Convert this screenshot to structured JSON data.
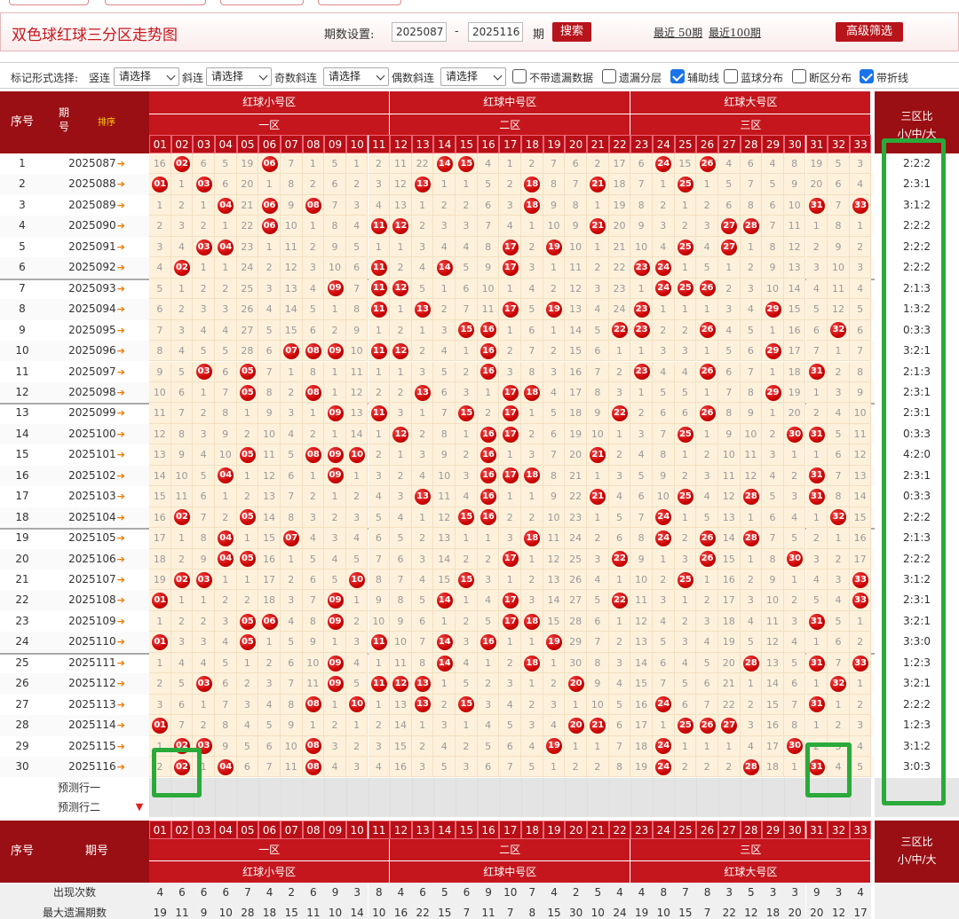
{
  "header": {
    "title": "双色球红球三分区走势图",
    "period_label": "期数设置:",
    "from": "2025087",
    "dash": "-",
    "to": "2025116",
    "qi": "期",
    "search_btn": "搜索",
    "recent50": "最近 50期",
    "recent100": "最近100期",
    "advanced_btn": "高级筛选"
  },
  "filters": {
    "mark_label": "标记形式选择:",
    "vertical": "竖连",
    "slant": "斜连",
    "odd_slant": "奇数斜连",
    "even_slant": "偶数斜连",
    "select_ph": "请选择",
    "cb1": "不带遗漏数据",
    "cb2": "遗漏分层",
    "cb3": "辅助线",
    "cb4": "蓝球分布",
    "cb5": "断区分布",
    "cb6": "带折线"
  },
  "table": {
    "col_no": "序号",
    "col_period": "期号",
    "sort_label": "排序",
    "zone_small": "红球小号区",
    "zone_mid": "红球中号区",
    "zone_big": "红球大号区",
    "zone1": "一区",
    "zone2": "二区",
    "zone3": "三区",
    "ratio_label": "三区比",
    "ratio_sub": "小/中/大",
    "nums": [
      "01",
      "02",
      "03",
      "04",
      "05",
      "06",
      "07",
      "08",
      "09",
      "10",
      "11",
      "12",
      "13",
      "14",
      "15",
      "16",
      "17",
      "18",
      "19",
      "20",
      "21",
      "22",
      "23",
      "24",
      "25",
      "26",
      "27",
      "28",
      "29",
      "30",
      "31",
      "32",
      "33"
    ],
    "predict1": "预测行一",
    "predict2": "预测行二",
    "stat_count_label": "出现次数",
    "stat_count": [
      4,
      6,
      6,
      6,
      7,
      4,
      2,
      6,
      9,
      3,
      8,
      4,
      6,
      5,
      6,
      9,
      10,
      7,
      4,
      2,
      5,
      4,
      4,
      8,
      7,
      8,
      3,
      5,
      3,
      3,
      9,
      3,
      4
    ],
    "stat_maxmiss_label": "最大遗漏期数",
    "stat_maxmiss": [
      19,
      11,
      9,
      10,
      28,
      18,
      15,
      11,
      10,
      14,
      10,
      16,
      22,
      15,
      7,
      11,
      7,
      8,
      15,
      30,
      10,
      24,
      19,
      10,
      15,
      7,
      22,
      12,
      18,
      20,
      20,
      12,
      17
    ],
    "rows": [
      {
        "no": 1,
        "period": "2025087",
        "ratio": "2:2:2",
        "cells": [
          16,
          "02",
          6,
          5,
          19,
          "06",
          7,
          1,
          5,
          1,
          2,
          11,
          22,
          "14",
          "15",
          4,
          1,
          2,
          7,
          6,
          2,
          17,
          6,
          "24",
          15,
          "26",
          4,
          6,
          4,
          8,
          19,
          5,
          3
        ]
      },
      {
        "no": 2,
        "period": "2025088",
        "ratio": "2:3:1",
        "cells": [
          "01",
          1,
          "03",
          6,
          20,
          1,
          8,
          2,
          6,
          2,
          3,
          12,
          "13",
          1,
          1,
          5,
          2,
          "18",
          8,
          7,
          "21",
          18,
          7,
          1,
          "25",
          1,
          5,
          7,
          5,
          9,
          20,
          6,
          4
        ]
      },
      {
        "no": 3,
        "period": "2025089",
        "ratio": "3:1:2",
        "cells": [
          1,
          2,
          1,
          "04",
          21,
          "06",
          9,
          "08",
          7,
          3,
          4,
          13,
          1,
          2,
          2,
          6,
          3,
          "18",
          9,
          8,
          1,
          19,
          8,
          2,
          1,
          2,
          6,
          8,
          6,
          10,
          "31",
          7,
          "33"
        ]
      },
      {
        "no": 4,
        "period": "2025090",
        "ratio": "2:2:2",
        "cells": [
          2,
          3,
          2,
          1,
          22,
          "06",
          10,
          1,
          8,
          4,
          "11",
          "12",
          2,
          3,
          3,
          7,
          4,
          1,
          10,
          9,
          "21",
          20,
          9,
          3,
          2,
          3,
          "27",
          "28",
          7,
          11,
          1,
          8,
          1
        ]
      },
      {
        "no": 5,
        "period": "2025091",
        "ratio": "2:2:2",
        "cells": [
          3,
          4,
          "03",
          "04",
          23,
          1,
          11,
          2,
          9,
          5,
          1,
          1,
          3,
          4,
          4,
          8,
          "17",
          2,
          "19",
          10,
          1,
          21,
          10,
          4,
          "25",
          4,
          "27",
          1,
          8,
          12,
          2,
          9,
          2
        ]
      },
      {
        "no": 6,
        "period": "2025092",
        "ratio": "2:2:2",
        "cells": [
          4,
          "02",
          1,
          1,
          24,
          2,
          12,
          3,
          10,
          6,
          "11",
          2,
          4,
          "14",
          5,
          9,
          "17",
          3,
          1,
          11,
          2,
          22,
          "23",
          "24",
          1,
          5,
          1,
          2,
          9,
          13,
          3,
          10,
          3
        ]
      },
      {
        "no": 7,
        "period": "2025093",
        "ratio": "2:1:3",
        "cells": [
          5,
          1,
          2,
          2,
          25,
          3,
          13,
          4,
          "09",
          7,
          "11",
          "12",
          5,
          1,
          6,
          10,
          1,
          4,
          2,
          12,
          3,
          23,
          1,
          "24",
          "25",
          "26",
          2,
          3,
          10,
          14,
          4,
          11,
          4
        ]
      },
      {
        "no": 8,
        "period": "2025094",
        "ratio": "1:3:2",
        "cells": [
          6,
          2,
          3,
          3,
          26,
          4,
          14,
          5,
          1,
          8,
          "11",
          1,
          "13",
          2,
          7,
          11,
          "17",
          5,
          "19",
          13,
          4,
          24,
          "23",
          1,
          1,
          1,
          3,
          4,
          "29",
          15,
          5,
          12,
          5
        ]
      },
      {
        "no": 9,
        "period": "2025095",
        "ratio": "0:3:3",
        "cells": [
          7,
          3,
          4,
          4,
          27,
          5,
          15,
          6,
          2,
          9,
          1,
          2,
          1,
          3,
          "15",
          "16",
          1,
          6,
          1,
          14,
          5,
          "22",
          "23",
          2,
          2,
          "26",
          4,
          5,
          1,
          16,
          6,
          "32",
          6
        ]
      },
      {
        "no": 10,
        "period": "2025096",
        "ratio": "3:2:1",
        "cells": [
          8,
          4,
          5,
          5,
          28,
          6,
          "07",
          "08",
          "09",
          10,
          "11",
          "12",
          2,
          4,
          1,
          "16",
          2,
          7,
          2,
          15,
          6,
          1,
          1,
          3,
          3,
          1,
          5,
          6,
          "29",
          17,
          7,
          1,
          7
        ]
      },
      {
        "no": 11,
        "period": "2025097",
        "ratio": "2:1:3",
        "cells": [
          9,
          5,
          "03",
          6,
          "05",
          7,
          1,
          8,
          1,
          11,
          1,
          1,
          3,
          5,
          2,
          "16",
          3,
          8,
          3,
          16,
          7,
          2,
          "23",
          4,
          4,
          "26",
          6,
          7,
          1,
          18,
          "31",
          2,
          8
        ]
      },
      {
        "no": 12,
        "period": "2025098",
        "ratio": "2:3:1",
        "cells": [
          10,
          6,
          1,
          7,
          "05",
          8,
          2,
          "08",
          1,
          12,
          2,
          2,
          "13",
          6,
          3,
          1,
          "17",
          "18",
          4,
          17,
          8,
          3,
          1,
          5,
          5,
          1,
          7,
          8,
          "29",
          19,
          1,
          3,
          9
        ]
      },
      {
        "no": 13,
        "period": "2025099",
        "ratio": "2:3:1",
        "cells": [
          11,
          7,
          2,
          8,
          1,
          9,
          3,
          1,
          "09",
          13,
          "11",
          3,
          1,
          7,
          "15",
          2,
          "17",
          1,
          5,
          18,
          9,
          "22",
          2,
          6,
          6,
          "26",
          8,
          9,
          1,
          20,
          2,
          4,
          10
        ]
      },
      {
        "no": 14,
        "period": "2025100",
        "ratio": "0:3:3",
        "cells": [
          12,
          8,
          3,
          9,
          2,
          10,
          4,
          2,
          1,
          14,
          1,
          "12",
          2,
          8,
          1,
          "16",
          "17",
          2,
          6,
          19,
          10,
          1,
          3,
          7,
          "25",
          1,
          9,
          10,
          2,
          "30",
          "31",
          5,
          11
        ]
      },
      {
        "no": 15,
        "period": "2025101",
        "ratio": "4:2:0",
        "cells": [
          13,
          9,
          4,
          10,
          "05",
          11,
          5,
          "08",
          "09",
          "10",
          2,
          1,
          3,
          9,
          2,
          "16",
          1,
          3,
          7,
          20,
          "21",
          2,
          4,
          8,
          1,
          2,
          10,
          11,
          3,
          1,
          1,
          6,
          12
        ]
      },
      {
        "no": 16,
        "period": "2025102",
        "ratio": "2:3:1",
        "cells": [
          14,
          10,
          5,
          "04",
          1,
          12,
          6,
          1,
          "09",
          1,
          3,
          2,
          4,
          10,
          3,
          "16",
          "17",
          "18",
          8,
          21,
          1,
          3,
          5,
          9,
          2,
          3,
          11,
          12,
          4,
          2,
          "31",
          7,
          13
        ]
      },
      {
        "no": 17,
        "period": "2025103",
        "ratio": "0:3:3",
        "cells": [
          15,
          11,
          6,
          1,
          2,
          13,
          7,
          2,
          1,
          2,
          4,
          3,
          "13",
          11,
          4,
          "16",
          1,
          1,
          9,
          22,
          "21",
          4,
          6,
          10,
          "25",
          4,
          12,
          "28",
          5,
          3,
          "31",
          8,
          14
        ]
      },
      {
        "no": 18,
        "period": "2025104",
        "ratio": "2:2:2",
        "cells": [
          16,
          "02",
          7,
          2,
          "05",
          14,
          8,
          3,
          2,
          3,
          5,
          4,
          1,
          12,
          "15",
          "16",
          2,
          2,
          10,
          23,
          1,
          5,
          7,
          "24",
          1,
          5,
          13,
          1,
          6,
          4,
          1,
          "32",
          15
        ]
      },
      {
        "no": 19,
        "period": "2025105",
        "ratio": "2:1:3",
        "cells": [
          17,
          1,
          8,
          "04",
          1,
          15,
          "07",
          4,
          3,
          4,
          6,
          5,
          2,
          13,
          1,
          1,
          3,
          "18",
          11,
          24,
          2,
          6,
          8,
          "24",
          2,
          "26",
          14,
          "28",
          7,
          5,
          2,
          1,
          16
        ]
      },
      {
        "no": 20,
        "period": "2025106",
        "ratio": "2:2:2",
        "cells": [
          18,
          2,
          9,
          "04",
          "05",
          16,
          1,
          5,
          4,
          5,
          7,
          6,
          3,
          14,
          2,
          2,
          "17",
          1,
          12,
          25,
          3,
          "22",
          9,
          1,
          3,
          "26",
          15,
          1,
          8,
          "30",
          3,
          2,
          17
        ]
      },
      {
        "no": 21,
        "period": "2025107",
        "ratio": "3:1:2",
        "cells": [
          19,
          "02",
          "03",
          1,
          1,
          17,
          2,
          6,
          5,
          "10",
          8,
          7,
          4,
          15,
          "15",
          3,
          1,
          2,
          13,
          26,
          4,
          1,
          10,
          2,
          "25",
          1,
          16,
          2,
          9,
          1,
          4,
          3,
          "33"
        ]
      },
      {
        "no": 22,
        "period": "2025108",
        "ratio": "2:3:1",
        "cells": [
          "01",
          1,
          1,
          2,
          2,
          18,
          3,
          7,
          "09",
          1,
          9,
          8,
          5,
          "14",
          1,
          4,
          "17",
          3,
          14,
          27,
          5,
          "22",
          11,
          3,
          1,
          2,
          17,
          3,
          10,
          2,
          5,
          4,
          "33"
        ]
      },
      {
        "no": 23,
        "period": "2025109",
        "ratio": "3:2:1",
        "cells": [
          1,
          2,
          2,
          3,
          "05",
          "06",
          4,
          8,
          "09",
          2,
          10,
          9,
          6,
          1,
          2,
          5,
          "17",
          "18",
          15,
          28,
          6,
          1,
          12,
          4,
          2,
          3,
          18,
          4,
          11,
          3,
          "31",
          5,
          1
        ]
      },
      {
        "no": 24,
        "period": "2025110",
        "ratio": "3:3:0",
        "cells": [
          "01",
          3,
          3,
          4,
          "05",
          1,
          5,
          9,
          1,
          3,
          "11",
          10,
          7,
          "14",
          3,
          "16",
          1,
          1,
          "19",
          29,
          7,
          2,
          13,
          5,
          3,
          4,
          19,
          5,
          12,
          4,
          1,
          6,
          2
        ]
      },
      {
        "no": 25,
        "period": "2025111",
        "ratio": "1:2:3",
        "cells": [
          1,
          4,
          4,
          5,
          1,
          2,
          6,
          10,
          "09",
          4,
          1,
          11,
          8,
          "14",
          4,
          1,
          2,
          "18",
          1,
          30,
          8,
          3,
          14,
          6,
          4,
          5,
          20,
          "28",
          13,
          5,
          "31",
          7,
          "33"
        ]
      },
      {
        "no": 26,
        "period": "2025112",
        "ratio": "3:2:1",
        "cells": [
          2,
          5,
          "03",
          6,
          2,
          3,
          7,
          11,
          "09",
          5,
          "11",
          "12",
          "13",
          1,
          5,
          2,
          3,
          1,
          2,
          "20",
          9,
          4,
          15,
          7,
          5,
          6,
          21,
          1,
          14,
          6,
          1,
          "32",
          1
        ]
      },
      {
        "no": 27,
        "period": "2025113",
        "ratio": "2:2:2",
        "cells": [
          3,
          6,
          1,
          7,
          3,
          4,
          8,
          "08",
          1,
          "10",
          1,
          13,
          "13",
          2,
          "15",
          3,
          4,
          2,
          3,
          1,
          10,
          5,
          16,
          "24",
          6,
          7,
          22,
          2,
          15,
          7,
          "31",
          1,
          2
        ]
      },
      {
        "no": 28,
        "period": "2025114",
        "ratio": "1:2:3",
        "cells": [
          "01",
          7,
          2,
          8,
          4,
          5,
          9,
          1,
          2,
          1,
          2,
          14,
          1,
          3,
          1,
          4,
          5,
          3,
          4,
          "20",
          "21",
          6,
          17,
          1,
          "25",
          "26",
          "27",
          3,
          16,
          8,
          1,
          2,
          3
        ]
      },
      {
        "no": 29,
        "period": "2025115",
        "ratio": "3:1:2",
        "cells": [
          1,
          "02",
          "03",
          9,
          5,
          6,
          10,
          "08",
          3,
          2,
          3,
          15,
          2,
          4,
          2,
          5,
          6,
          4,
          "19",
          1,
          1,
          7,
          18,
          "24",
          1,
          1,
          1,
          4,
          17,
          "30",
          2,
          3,
          4
        ]
      },
      {
        "no": 30,
        "period": "2025116",
        "ratio": "3:0:3",
        "cells": [
          2,
          "02",
          1,
          "04",
          6,
          7,
          11,
          "08",
          4,
          3,
          4,
          16,
          3,
          5,
          3,
          6,
          7,
          5,
          1,
          2,
          2,
          8,
          19,
          "24",
          2,
          2,
          2,
          "28",
          18,
          1,
          "31",
          4,
          5
        ]
      }
    ]
  },
  "colors": {
    "brand_red": "#c5161d",
    "highlight_green": "#2aaa3a",
    "cell_bg": "#fdf1dc"
  }
}
